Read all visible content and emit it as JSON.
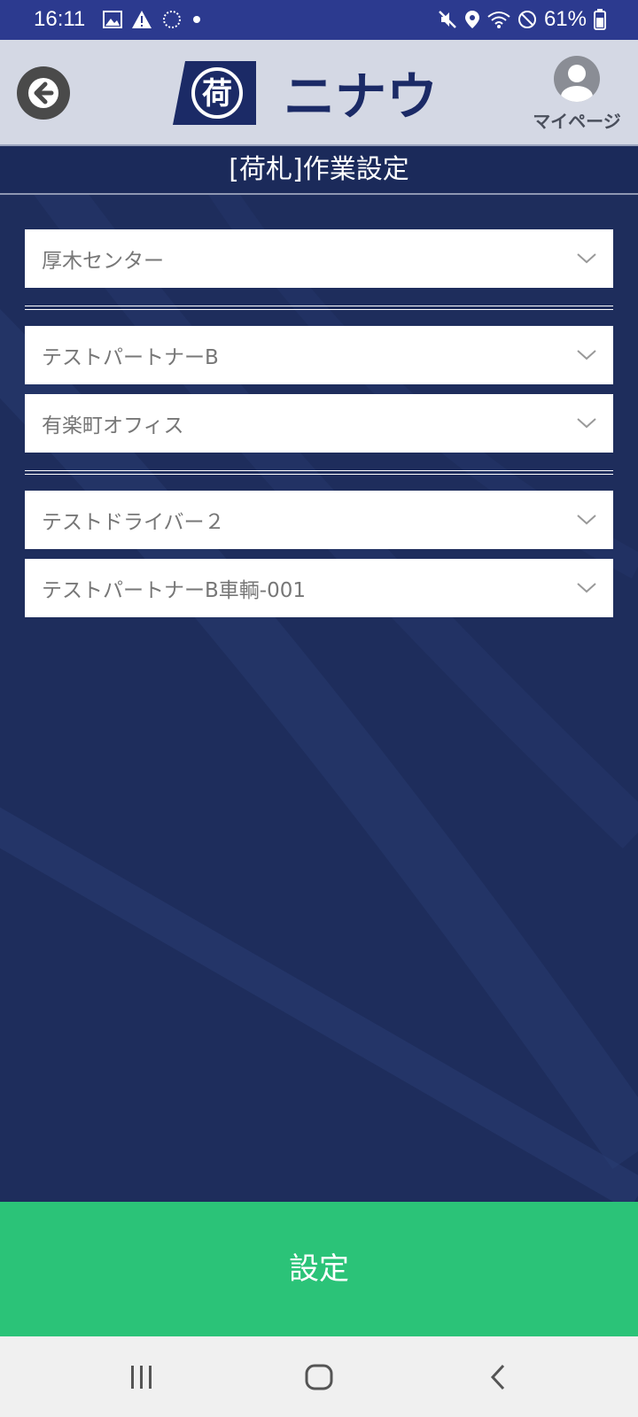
{
  "status_bar": {
    "time": "16:11",
    "battery": "61%",
    "left_icons": [
      "image-icon",
      "warning-icon",
      "sync-icon",
      "dot-icon"
    ],
    "right_icons": [
      "mute-icon",
      "location-icon",
      "wifi-icon",
      "dnd-icon",
      "battery-icon"
    ]
  },
  "header": {
    "back_icon": "arrow-left-icon",
    "logo_text": "ニナウ",
    "logo_mark": "荷",
    "mypage_label": "マイページ"
  },
  "title": "[荷札]作業設定",
  "selects": {
    "center": "厚木センター",
    "partner": "テストパートナーB",
    "office": "有楽町オフィス",
    "driver": "テストドライバー２",
    "vehicle": "テストパートナーB車輌-001"
  },
  "submit_label": "設定",
  "colors": {
    "status_bar": "#2c3a8f",
    "header_bg": "#d4d8e4",
    "navy": "#1e2d5c",
    "submit_green": "#2bc378"
  }
}
